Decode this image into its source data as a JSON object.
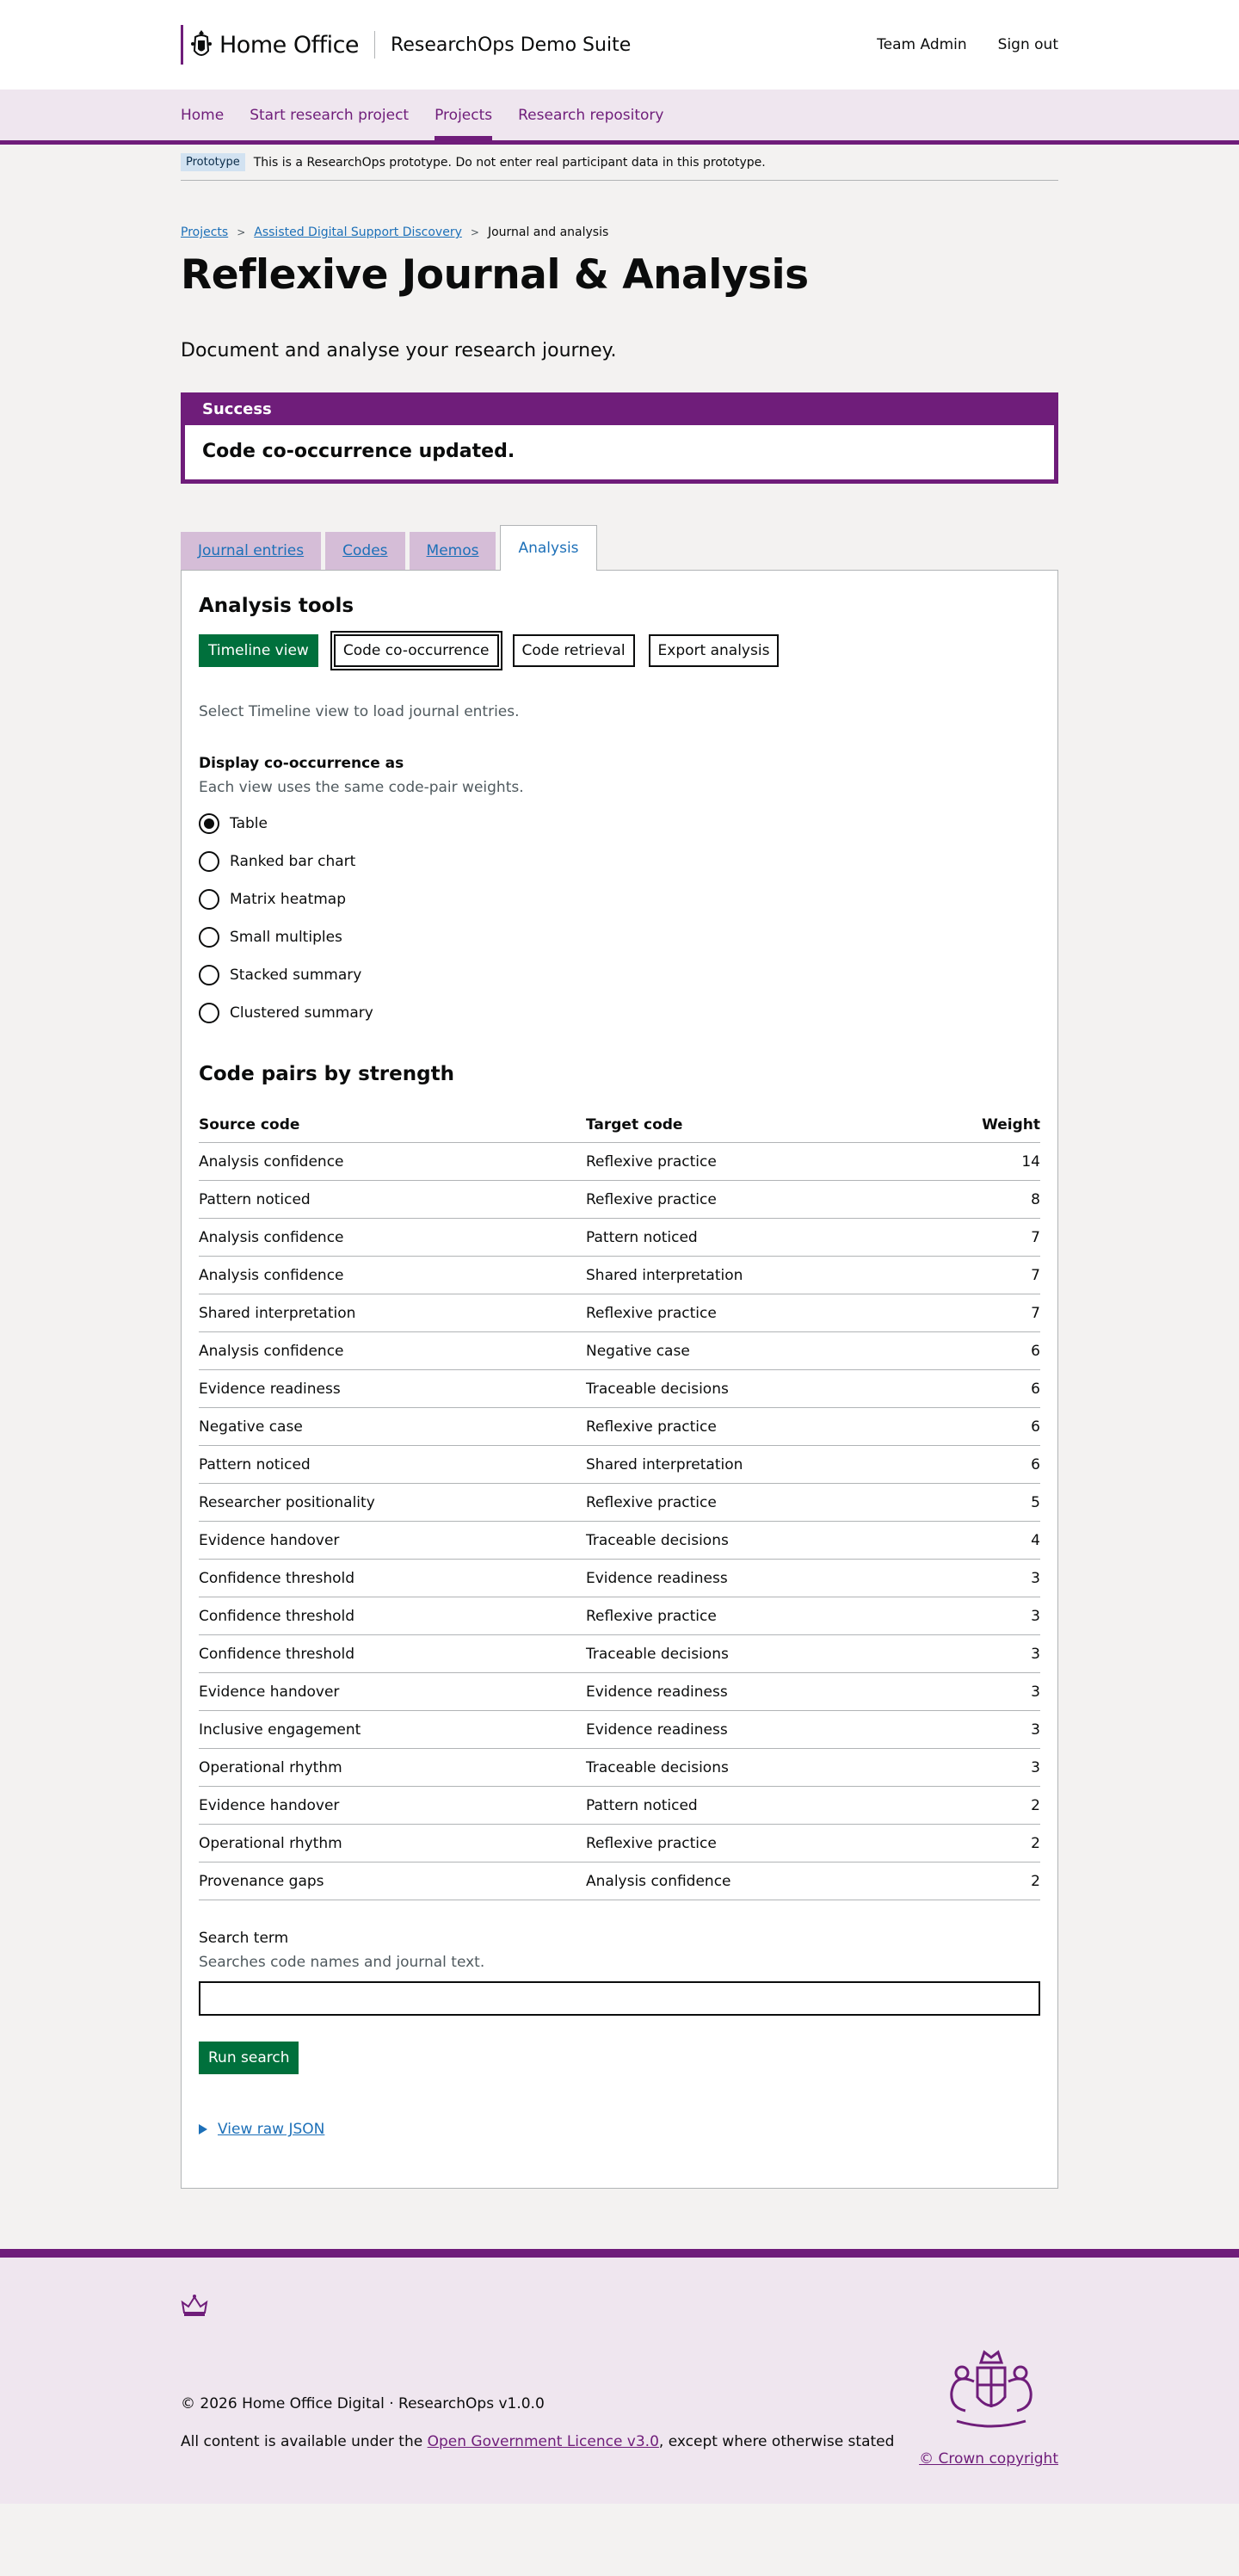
{
  "header": {
    "org_name": "Home Office",
    "service_name": "ResearchOps Demo Suite",
    "links": [
      "Team Admin",
      "Sign out"
    ]
  },
  "nav": {
    "items": [
      {
        "label": "Home"
      },
      {
        "label": "Start research project"
      },
      {
        "label": "Projects"
      },
      {
        "label": "Research repository"
      }
    ]
  },
  "phase": {
    "tag": "Prototype",
    "text": "This is a ResearchOps prototype. Do not enter real participant data in this prototype."
  },
  "breadcrumb": [
    "Projects",
    "Assisted Digital Support Discovery",
    "Journal and analysis"
  ],
  "page": {
    "title": "Reflexive Journal & Analysis",
    "lead": "Document and analyse your research journey."
  },
  "banner": {
    "heading": "Success",
    "message": "Code co-occurrence updated."
  },
  "tabs": [
    "Journal entries",
    "Codes",
    "Memos",
    "Analysis"
  ],
  "analysis": {
    "heading": "Analysis tools",
    "tools": [
      "Timeline view",
      "Code co-occurrence",
      "Code retrieval",
      "Export analysis"
    ],
    "timeline_hint": "Select Timeline view to load journal entries.",
    "display_legend": "Display co-occurrence as",
    "display_hint": "Each view uses the same code-pair weights.",
    "display_options": [
      "Table",
      "Ranked bar chart",
      "Matrix heatmap",
      "Small multiples",
      "Stacked summary",
      "Clustered summary"
    ],
    "selected_option": "Table",
    "pairs_heading": "Code pairs by strength",
    "columns": [
      "Source code",
      "Target code",
      "Weight"
    ],
    "rows": [
      [
        "Analysis confidence",
        "Reflexive practice",
        "14"
      ],
      [
        "Pattern noticed",
        "Reflexive practice",
        "8"
      ],
      [
        "Analysis confidence",
        "Pattern noticed",
        "7"
      ],
      [
        "Analysis confidence",
        "Shared interpretation",
        "7"
      ],
      [
        "Shared interpretation",
        "Reflexive practice",
        "7"
      ],
      [
        "Analysis confidence",
        "Negative case",
        "6"
      ],
      [
        "Evidence readiness",
        "Traceable decisions",
        "6"
      ],
      [
        "Negative case",
        "Reflexive practice",
        "6"
      ],
      [
        "Pattern noticed",
        "Shared interpretation",
        "6"
      ],
      [
        "Researcher positionality",
        "Reflexive practice",
        "5"
      ],
      [
        "Evidence handover",
        "Traceable decisions",
        "4"
      ],
      [
        "Confidence threshold",
        "Evidence readiness",
        "3"
      ],
      [
        "Confidence threshold",
        "Reflexive practice",
        "3"
      ],
      [
        "Confidence threshold",
        "Traceable decisions",
        "3"
      ],
      [
        "Evidence handover",
        "Evidence readiness",
        "3"
      ],
      [
        "Inclusive engagement",
        "Evidence readiness",
        "3"
      ],
      [
        "Operational rhythm",
        "Traceable decisions",
        "3"
      ],
      [
        "Evidence handover",
        "Pattern noticed",
        "2"
      ],
      [
        "Operational rhythm",
        "Reflexive practice",
        "2"
      ],
      [
        "Provenance gaps",
        "Analysis confidence",
        "2"
      ]
    ],
    "search_label": "Search term",
    "search_hint": "Searches code names and journal text.",
    "search_value": "",
    "run_label": "Run search",
    "raw_json_label": "View raw JSON"
  },
  "footer": {
    "line1": "© 2026 Home Office Digital · ResearchOps v1.0.0",
    "licence_prefix": "All content is available under the ",
    "licence_link": "Open Government Licence v3.0",
    "licence_suffix": ", except where otherwise stated",
    "copyright": "© Crown copyright"
  },
  "colors": {
    "brand": "#6f1d7a",
    "primary_button": "#00703c",
    "link": "#1d70b8"
  }
}
